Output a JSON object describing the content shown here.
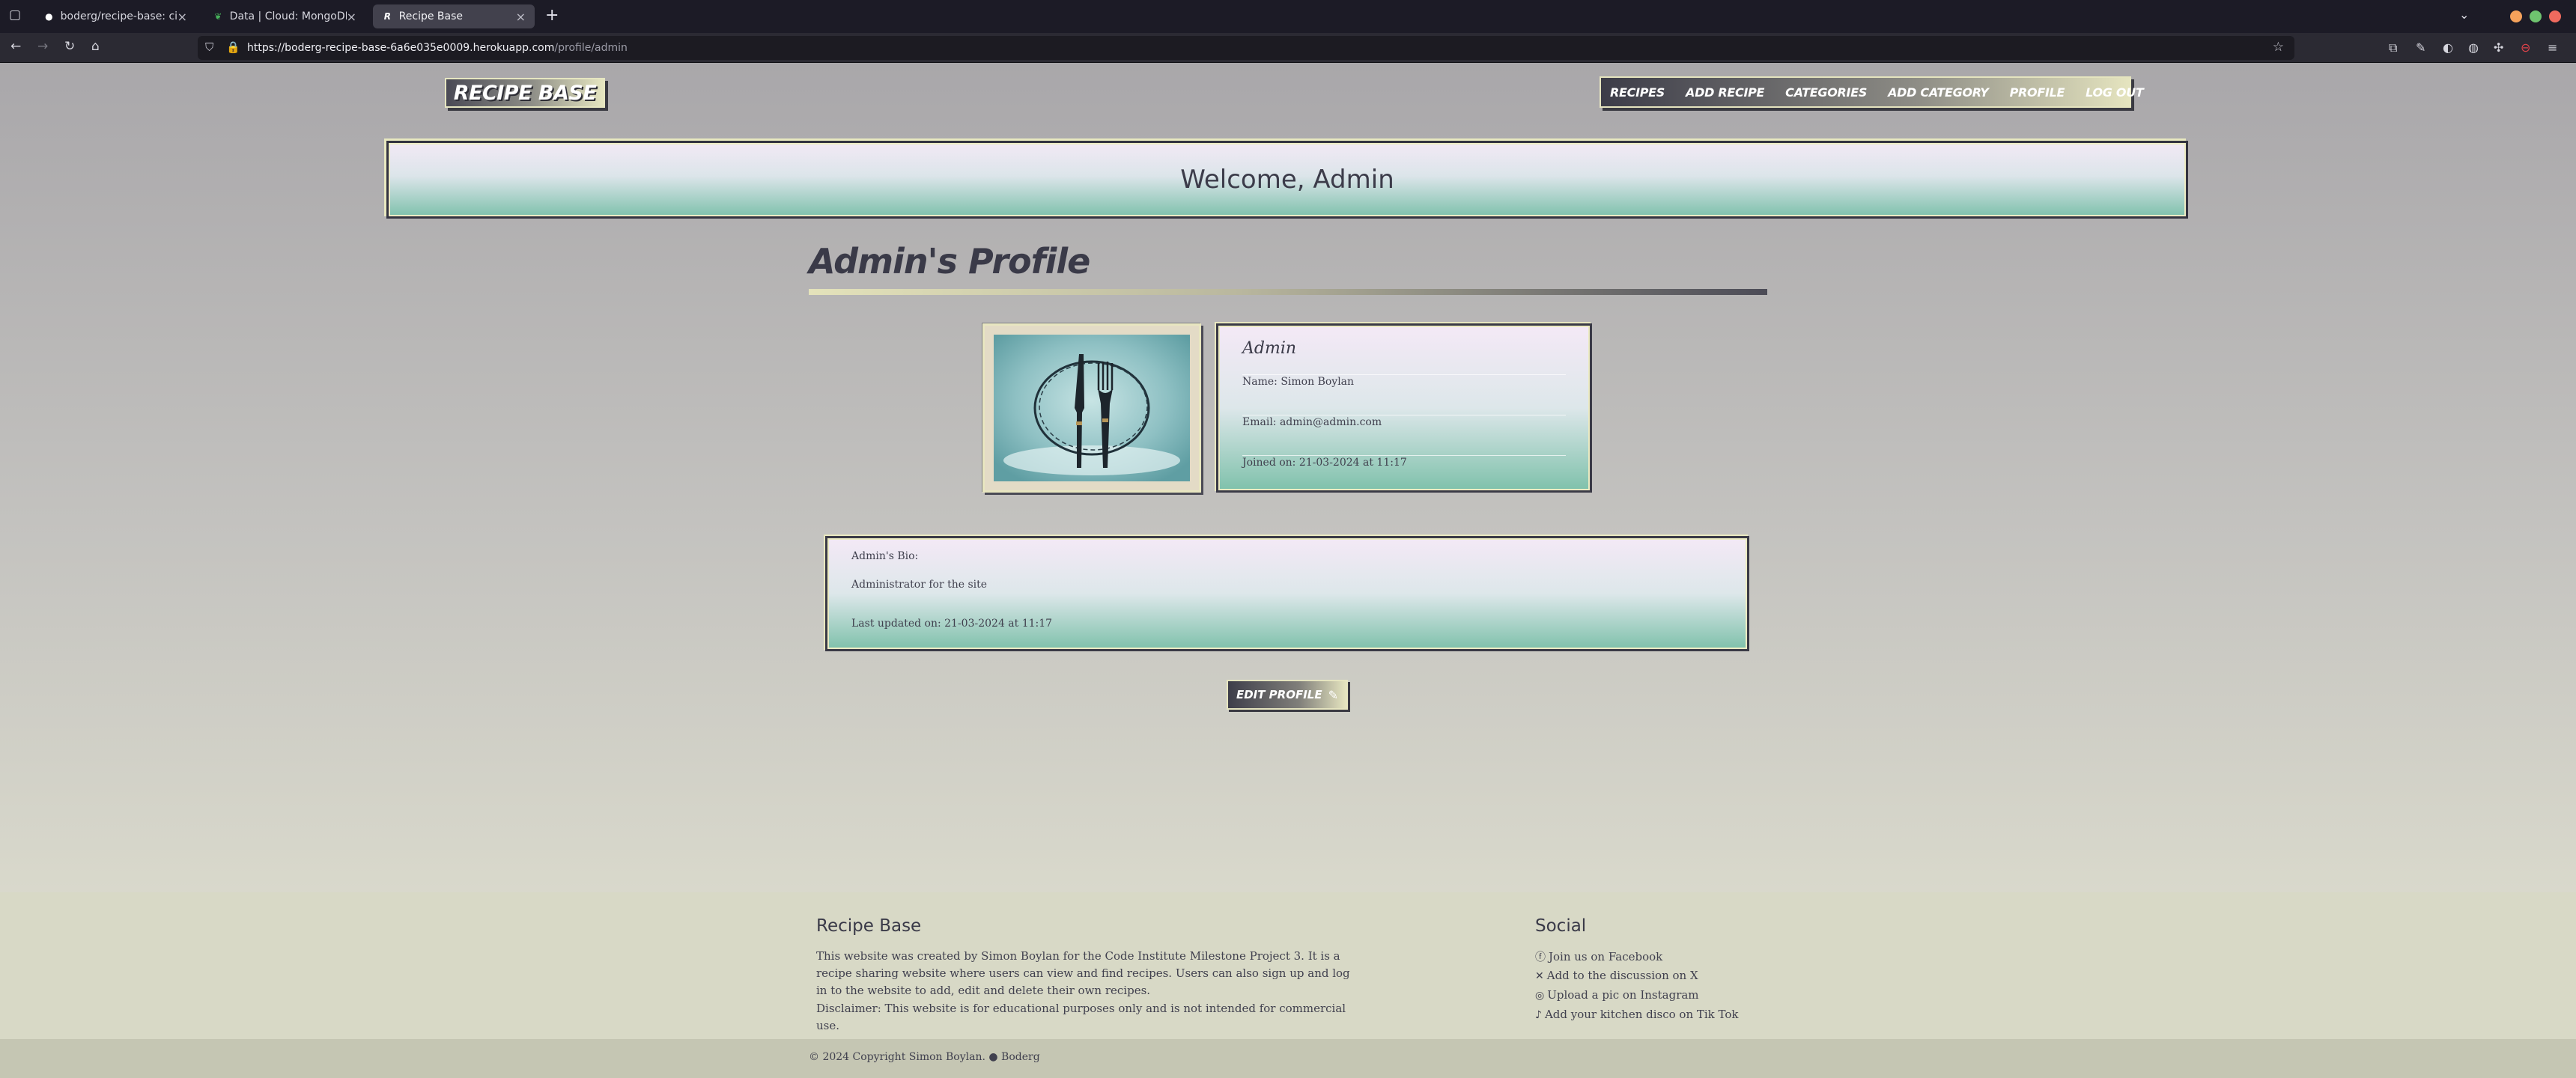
{
  "browser": {
    "tabs": [
      {
        "title": "boderg/recipe-base: ci mile",
        "favicon": "github-icon"
      },
      {
        "title": "Data | Cloud: MongoDB Clo",
        "favicon": "mongodb-leaf-icon"
      },
      {
        "title": "Recipe Base",
        "favicon": "recipe-base-r-icon"
      }
    ],
    "new_tab_symbol": "+",
    "url_host": "https://boderg-recipe-base-6a6e035e0009.herokuapp.com",
    "url_path": "/profile/admin",
    "window_controls_colors": [
      "#f5a25b",
      "#6fc36f",
      "#f06a5e"
    ]
  },
  "site": {
    "logo": "RECIPE BASE",
    "nav": [
      "RECIPES",
      "ADD RECIPE",
      "CATEGORIES",
      "ADD CATEGORY",
      "PROFILE",
      "LOG OUT"
    ]
  },
  "welcome": "Welcome, Admin",
  "profile": {
    "heading": "Admin's Profile",
    "username": "Admin",
    "name": "Name: Simon Boylan",
    "email": "Email: admin@admin.com",
    "joined": "Joined on: 21-03-2024 at 11:17",
    "image": "knife-and-fork-wreath-image"
  },
  "bio": {
    "label": "Admin's Bio:",
    "text": "Administrator for the site",
    "updated": "Last updated on: 21-03-2024 at 11:17"
  },
  "edit_button": "EDIT PROFILE",
  "footer": {
    "title": "Recipe Base",
    "description": "This website was created by Simon Boylan for the Code Institute Milestone Project 3. It is a recipe sharing website where users can view and find recipes. Users can also sign up and log in to the website to add, edit and delete their own recipes.",
    "disclaimer": "Disclaimer: This website is for educational purposes only and is not intended for commercial use.",
    "social_title": "Social",
    "social_links": [
      {
        "label": "Join us on Facebook",
        "icon": "facebook-icon"
      },
      {
        "label": "Add to the discussion on X",
        "icon": "x-icon"
      },
      {
        "label": "Upload a pic on Instagram",
        "icon": "instagram-icon"
      },
      {
        "label": "Add your kitchen disco on Tik Tok",
        "icon": "tiktok-icon"
      }
    ],
    "copyright": "© 2024 Copyright Simon Boylan.",
    "github_label": "Boderg"
  },
  "colors": {
    "accent_cream": "#e6e5c0",
    "accent_dark": "#3a3a48",
    "card_teal": "#7fc1ab",
    "card_lavender": "#f4e9f6"
  }
}
